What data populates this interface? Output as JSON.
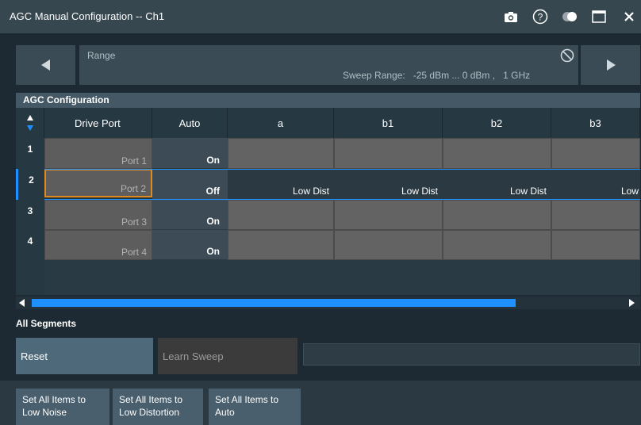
{
  "window": {
    "title": "AGC Manual Configuration -- Ch1"
  },
  "range": {
    "label": "Range",
    "sweep_text": "Sweep Range:   -25 dBm ... 0 dBm ,   1 GHz"
  },
  "section": {
    "title": "AGC Configuration"
  },
  "table": {
    "headers": [
      "Drive Port",
      "Auto",
      "a",
      "b1",
      "b2",
      "b3"
    ],
    "rows": [
      {
        "num": "1",
        "port": "Port 1",
        "auto": "On",
        "a": "",
        "b1": "",
        "b2": "",
        "b3": ""
      },
      {
        "num": "2",
        "port": "Port 2",
        "auto": "Off",
        "a": "Low Dist",
        "b1": "Low Dist",
        "b2": "Low Dist",
        "b3": "Low"
      },
      {
        "num": "3",
        "port": "Port 3",
        "auto": "On",
        "a": "",
        "b1": "",
        "b2": "",
        "b3": ""
      },
      {
        "num": "4",
        "port": "Port 4",
        "auto": "On",
        "a": "",
        "b1": "",
        "b2": "",
        "b3": ""
      }
    ]
  },
  "all_segments": {
    "title": "All Segments",
    "reset_label": "Reset",
    "learn_label": "Learn Sweep"
  },
  "bottom": {
    "btn_low_noise": "Set All Items to\nLow Noise",
    "btn_low_distortion": "Set All Items to\nLow Distortion",
    "btn_auto": "Set All Items to\nAuto"
  },
  "colors": {
    "accent": "#1e90ff",
    "selected_cell_border": "#e08a1e"
  }
}
